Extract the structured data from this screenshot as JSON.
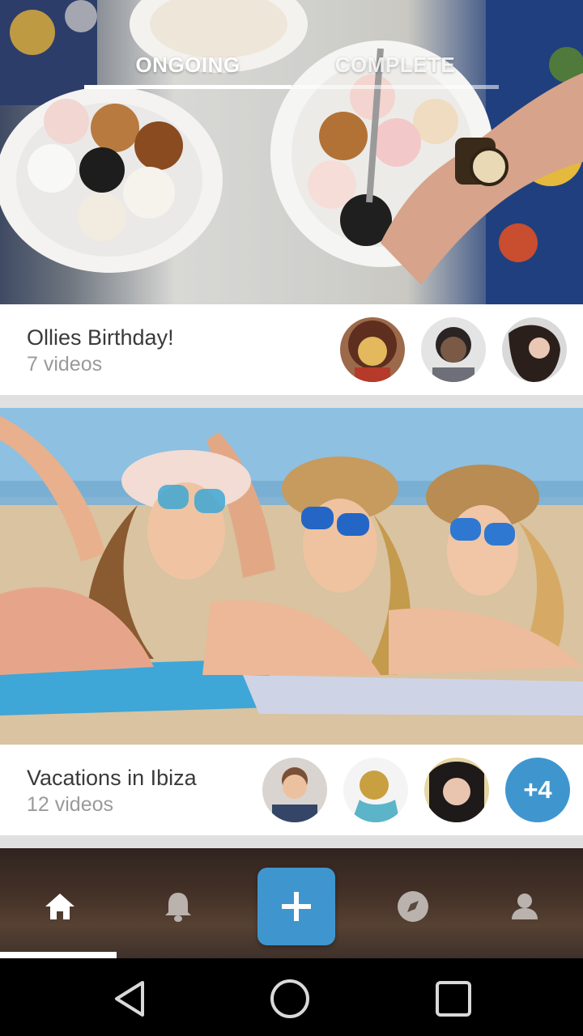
{
  "tabs": {
    "ongoing_label": "ONGOING",
    "complete_label": "COMPLETE",
    "active": "ongoing"
  },
  "events": [
    {
      "title": "Ollies Birthday!",
      "subtitle": "7 videos",
      "participants": [
        "participant-1",
        "participant-2",
        "participant-3"
      ]
    },
    {
      "title": "Vacations in Ibiza",
      "subtitle": "12 videos",
      "participants": [
        "participant-1",
        "participant-2",
        "participant-3"
      ],
      "more_label": "+4"
    }
  ],
  "bottom_nav": {
    "items": [
      "home-icon",
      "bell-icon",
      "add-icon",
      "compass-icon",
      "profile-icon"
    ],
    "active": "home-icon"
  },
  "system_nav": {
    "items": [
      "back-icon",
      "home-circle-icon",
      "recents-icon"
    ]
  },
  "colors": {
    "accent": "#3f96cf",
    "title_text": "#3a3a3a",
    "subtitle_text": "#9a9a9a"
  }
}
